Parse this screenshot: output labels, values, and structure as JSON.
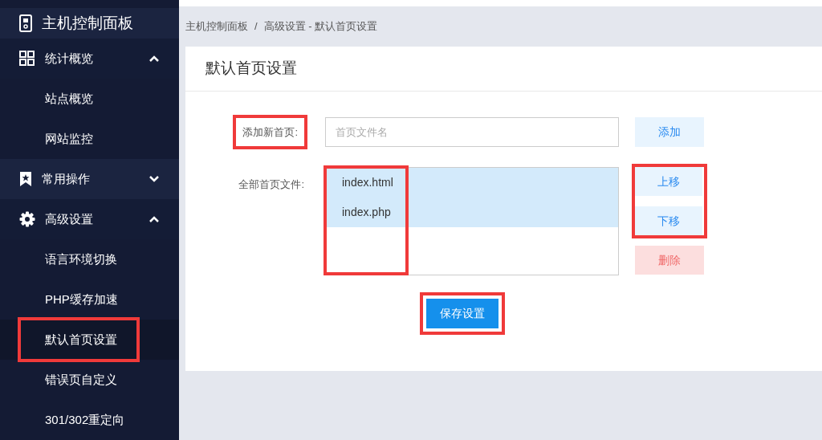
{
  "sidebar": {
    "title": "主机控制面板",
    "groups": [
      {
        "label": "统计概览",
        "kind": "grid",
        "expanded": true,
        "items": [
          {
            "label": "站点概览",
            "selected": false,
            "highlighted": false
          },
          {
            "label": "网站监控",
            "selected": false,
            "highlighted": false
          }
        ]
      },
      {
        "label": "常用操作",
        "kind": "bookmark",
        "expanded": false
      },
      {
        "label": "高级设置",
        "kind": "gear",
        "expanded": true,
        "items": [
          {
            "label": "语言环境切换",
            "selected": false,
            "highlighted": false
          },
          {
            "label": "PHP缓存加速",
            "selected": false,
            "highlighted": false
          },
          {
            "label": "默认首页设置",
            "selected": true,
            "highlighted": true
          },
          {
            "label": "错误页自定义",
            "selected": false,
            "highlighted": false
          },
          {
            "label": "301/302重定向",
            "selected": false,
            "highlighted": false
          }
        ]
      }
    ]
  },
  "breadcrumb": {
    "separator": "/",
    "items": [
      "主机控制面板",
      "高级设置 - 默认首页设置"
    ]
  },
  "card": {
    "title": "默认首页设置",
    "add_row": {
      "label": "添加新首页:",
      "highlighted": true,
      "placeholder": "首页文件名",
      "button": "添加"
    },
    "files_row": {
      "label": "全部首页文件:",
      "names_highlighted": true,
      "files": [
        {
          "name": "index.html",
          "selected": true
        },
        {
          "name": "index.php",
          "selected": true
        }
      ],
      "move_buttons_highlighted": true,
      "up_button": "上移",
      "down_button": "下移",
      "delete_button": "删除"
    },
    "save_button": {
      "label": "保存设置",
      "highlighted": true
    }
  }
}
